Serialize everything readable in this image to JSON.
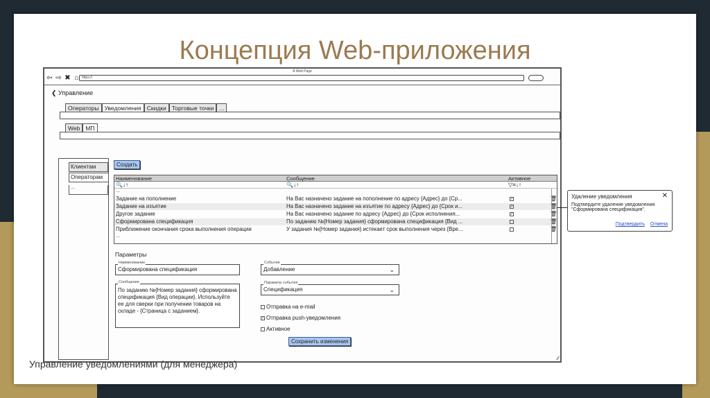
{
  "slide": {
    "title": "Концепция Web-приложения",
    "caption": "Управление уведомлениями (для менеджера)"
  },
  "browser": {
    "window_title": "A Web Page",
    "url": "https://"
  },
  "back_label": "Управление",
  "top_tabs": [
    "Операторы",
    "Уведомления",
    "Скидки",
    "Торговые точки",
    "..."
  ],
  "sub_tabs": [
    "Web",
    "МП"
  ],
  "sidebar": {
    "items": [
      "Клиентам",
      "Операторам"
    ],
    "more": "..."
  },
  "create_button": "Создать",
  "grid": {
    "columns": [
      "Наименование",
      "Сообщение",
      "Активное"
    ],
    "filter_search": "🔍↓↑",
    "filter_active": "▽≡↓↑",
    "ellipsis": "...",
    "rows": [
      {
        "name": "Задание на пополнение",
        "message": "На Вас назначено задание на пополнение по адресу {Адрес} до {Ср...",
        "active": true
      },
      {
        "name": "Задание на изъятие",
        "message": "На Вас назначено задание на изъятие по адресу {Адрес} до {Срок и...",
        "active": true
      },
      {
        "name": "Другое задание",
        "message": "На Вас назначено задание по адресу {Адрес} до {Срок исполнения...",
        "active": true
      },
      {
        "name": "Сформирована спецификация",
        "message": "По заданию №{Номер задания} сформирована спецификация {Вид ...",
        "active": false
      },
      {
        "name": "Приближение окончания срока выполнения операции",
        "message": "У задания №{Номер задания} истекает срок выполнения через {Вре...",
        "active": false
      }
    ]
  },
  "params": {
    "title": "Параметры",
    "name_label": "Наименование",
    "name_value": "Сформирована спецификация",
    "message_label": "Сообщение",
    "message_value": "По заданию №{Номер задания} сформирована спецификация {Вид операции}. Используйте ее для сверки при получении товаров на складе - {Страница с заданием}.",
    "event_label": "Событие",
    "event_value": "Добавление",
    "event_param_label": "Параметр события",
    "event_param_value": "Спецификация",
    "options": [
      {
        "label": "Отправка на e-mail",
        "checked": false
      },
      {
        "label": "Отправка push-уведомления",
        "checked": true
      },
      {
        "label": "Активное",
        "checked": false
      }
    ],
    "save_button": "Сохранить изменения"
  },
  "dialog": {
    "title": "Удаление уведомления",
    "text": "Подтвердите удаление уведомления \"Сформирована спецификация\".",
    "confirm": "Подтвердить",
    "cancel": "Отмена"
  },
  "colors": {
    "title": "#9c7a50",
    "button": "#a9c7ef",
    "link": "#2a4fd0",
    "gold": "#b49a5a"
  },
  "icons": [
    "back-arrow-icon",
    "forward-arrow-icon",
    "close-icon",
    "home-icon",
    "search-icon",
    "sort-icon",
    "filter-icon",
    "trash-icon",
    "checkbox-icon",
    "chevron-down-icon",
    "resize-grip-icon"
  ]
}
